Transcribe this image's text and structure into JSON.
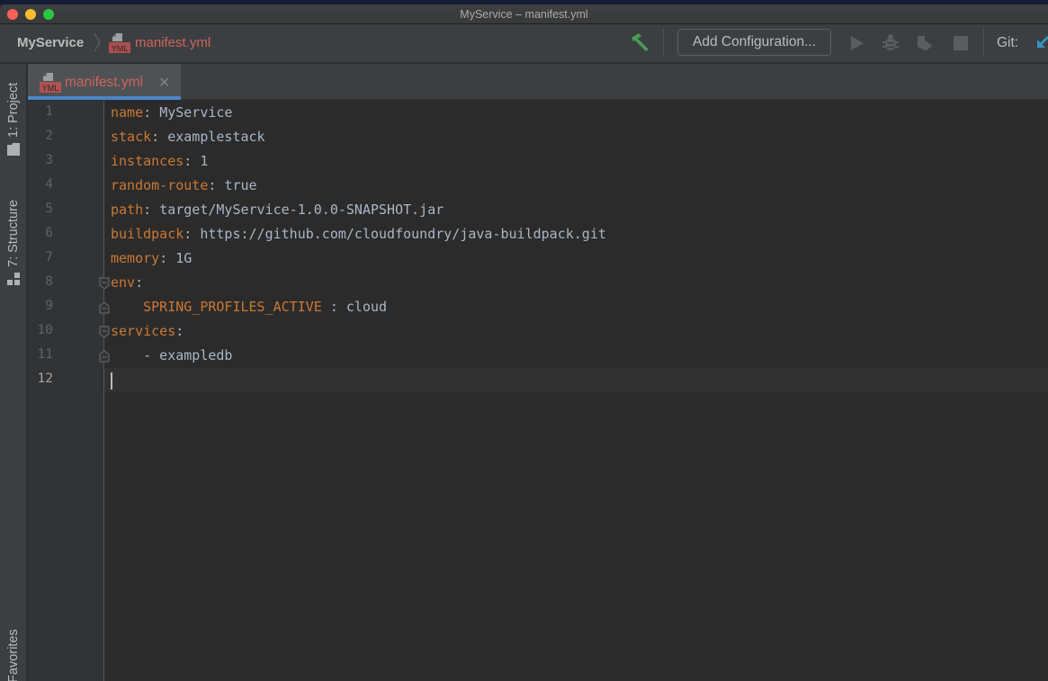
{
  "window": {
    "title": "MyService – manifest.yml",
    "controls": [
      "close",
      "minimize",
      "maximize"
    ]
  },
  "navbar": {
    "breadcrumb": {
      "project": "MyService",
      "separator_icon": "chevron-right-icon",
      "file_icon": "yml-file-icon",
      "file": "manifest.yml"
    },
    "toolbar": {
      "build_icon": "hammer-icon",
      "add_configuration_label": "Add Configuration...",
      "run_icon": "run-icon",
      "debug_icon": "debug-icon",
      "coverage_icon": "coverage-icon",
      "stop_icon": "stop-icon",
      "git_label": "Git:",
      "git_update_icon": "git-update-arrow-icon"
    }
  },
  "left_strip": {
    "tabs": [
      {
        "label": "1: Project",
        "icon": "folder-icon"
      },
      {
        "label": "7: Structure",
        "icon": "structure-icon"
      },
      {
        "label": "Favorites"
      }
    ]
  },
  "editor_tabs": [
    {
      "label": "manifest.yml",
      "icon": "yml-file-icon",
      "active": true,
      "close_icon": "close-icon"
    }
  ],
  "editor": {
    "file_icon_label": "YML",
    "current_line": 12,
    "lines": [
      {
        "n": "1",
        "key": "name",
        "sep": ": ",
        "value": "MyService",
        "indent": ""
      },
      {
        "n": "2",
        "key": "stack",
        "sep": ": ",
        "value": "examplestack",
        "indent": ""
      },
      {
        "n": "3",
        "key": "instances",
        "sep": ": ",
        "value": "1",
        "indent": ""
      },
      {
        "n": "4",
        "key": "random-route",
        "sep": ": ",
        "value": "true",
        "indent": ""
      },
      {
        "n": "5",
        "key": "path",
        "sep": ": ",
        "value": "target/MyService-1.0.0-SNAPSHOT.jar",
        "indent": ""
      },
      {
        "n": "6",
        "key": "buildpack",
        "sep": ": ",
        "value": "https://github.com/cloudfoundry/java-buildpack.git",
        "indent": ""
      },
      {
        "n": "7",
        "key": "memory",
        "sep": ": ",
        "value": "1G",
        "indent": ""
      },
      {
        "n": "8",
        "key": "env",
        "sep": ":",
        "value": "",
        "indent": ""
      },
      {
        "n": "9",
        "key": "SPRING_PROFILES_ACTIVE",
        "sep": " : ",
        "value": "cloud",
        "indent": "    "
      },
      {
        "n": "10",
        "key": "services",
        "sep": ":",
        "value": "",
        "indent": ""
      },
      {
        "n": "11",
        "key": "",
        "sep": "",
        "value": "- exampledb",
        "indent": "    "
      },
      {
        "n": "12",
        "key": "",
        "sep": "",
        "value": "",
        "indent": ""
      }
    ]
  },
  "colors": {
    "yaml_key": "#cc7832",
    "yaml_value": "#a9b7c6",
    "file_name_modified": "#d0625d",
    "tab_underline": "#4a88c7",
    "build_hammer": "#499c54",
    "git_arrow": "#3592c4"
  }
}
